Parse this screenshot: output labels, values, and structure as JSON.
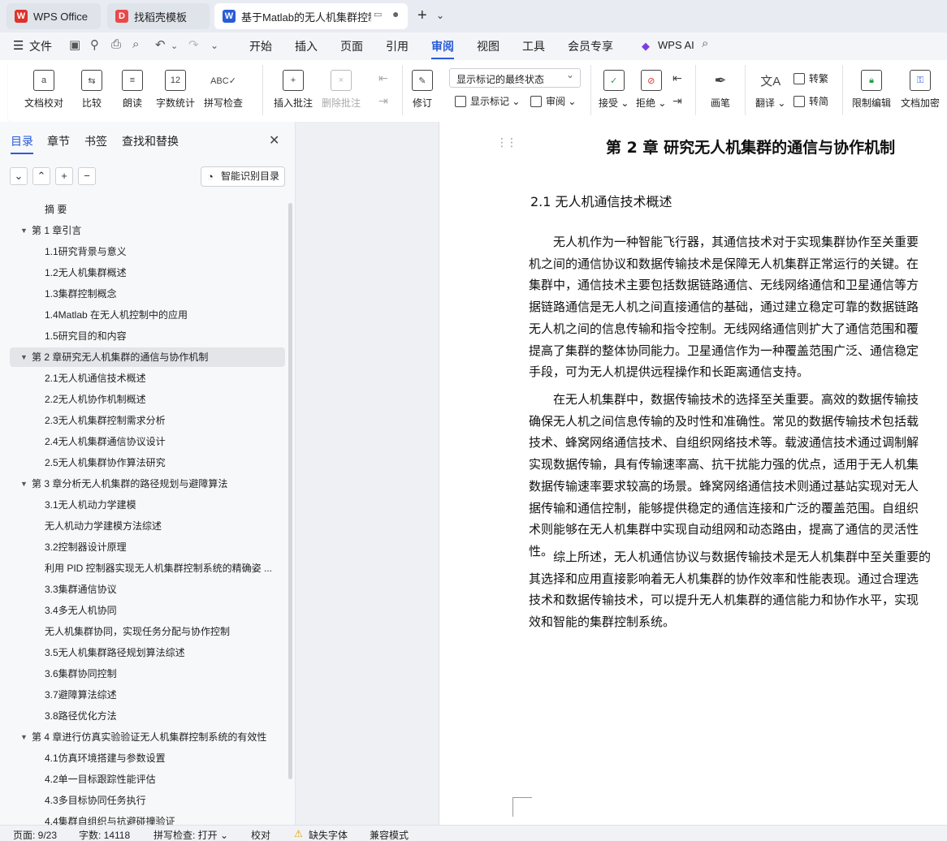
{
  "tabs": [
    {
      "label": "WPS Office",
      "icon": "wps-logo-icon",
      "color": "#e0312b"
    },
    {
      "label": "找稻壳模板",
      "icon": "docer-logo-icon",
      "color": "#e84949"
    },
    {
      "label": "基于Matlab的无人机集群控制",
      "icon": "word-doc-icon",
      "color": "#2a5cd8"
    }
  ],
  "menu": {
    "file": "文件",
    "items": [
      "开始",
      "插入",
      "页面",
      "引用",
      "审阅",
      "视图",
      "工具",
      "会员专享"
    ],
    "active": "审阅",
    "wps_ai": "WPS AI"
  },
  "ribbon": {
    "doc_check": "文档校对",
    "compare": "比较",
    "read_aloud": "朗读",
    "word_count": "字数统计",
    "spell_check": "拼写检查",
    "insert_comment": "插入批注",
    "delete_comment": "删除批注",
    "revise": "修订",
    "markup_state": "显示标记的最终状态",
    "show_markup": "显示标记",
    "review": "审阅",
    "accept": "接受",
    "reject": "拒绝",
    "pen": "画笔",
    "translate": "翻译",
    "to_traditional": "转繁",
    "to_simplified": "转简",
    "restrict_edit": "限制编辑",
    "doc_encrypt": "文档加密"
  },
  "sidebar": {
    "tabs": [
      "目录",
      "章节",
      "书签",
      "查找和替换"
    ],
    "smart_toc": "智能识别目录",
    "toc": [
      {
        "label": "摘 要",
        "level": 2
      },
      {
        "label": "第 1 章引言",
        "level": 1
      },
      {
        "label": "1.1研究背景与意义",
        "level": 2
      },
      {
        "label": "1.2无人机集群概述",
        "level": 2
      },
      {
        "label": "1.3集群控制概念",
        "level": 2
      },
      {
        "label": "1.4Matlab 在无人机控制中的应用",
        "level": 2
      },
      {
        "label": "1.5研究目的和内容",
        "level": 2
      },
      {
        "label": "第 2 章研究无人机集群的通信与协作机制",
        "level": 1,
        "selected": true
      },
      {
        "label": "2.1无人机通信技术概述",
        "level": 2
      },
      {
        "label": "2.2无人机协作机制概述",
        "level": 2
      },
      {
        "label": "2.3无人机集群控制需求分析",
        "level": 2
      },
      {
        "label": "2.4无人机集群通信协议设计",
        "level": 2
      },
      {
        "label": "2.5无人机集群协作算法研究",
        "level": 2
      },
      {
        "label": "第 3 章分析无人机集群的路径规划与避障算法",
        "level": 1
      },
      {
        "label": "3.1无人机动力学建模",
        "level": 2
      },
      {
        "label": "无人机动力学建模方法综述",
        "level": 2
      },
      {
        "label": "3.2控制器设计原理",
        "level": 2
      },
      {
        "label": "利用 PID 控制器实现无人机集群控制系统的精确姿 ...",
        "level": 2
      },
      {
        "label": "3.3集群通信协议",
        "level": 2
      },
      {
        "label": "3.4多无人机协同",
        "level": 2
      },
      {
        "label": "无人机集群协同，实现任务分配与协作控制",
        "level": 2
      },
      {
        "label": "3.5无人机集群路径规划算法综述",
        "level": 2
      },
      {
        "label": "3.6集群协同控制",
        "level": 2
      },
      {
        "label": "3.7避障算法综述",
        "level": 2
      },
      {
        "label": "3.8路径优化方法",
        "level": 2
      },
      {
        "label": "第 4 章进行仿真实验验证无人机集群控制系统的有效性",
        "level": 1
      },
      {
        "label": "4.1仿真环境搭建与参数设置",
        "level": 2
      },
      {
        "label": "4.2单一目标跟踪性能评估",
        "level": 2
      },
      {
        "label": "4.3多目标协同任务执行",
        "level": 2
      },
      {
        "label": "4.4集群自组织与抗避碰撞验证",
        "level": 2
      }
    ]
  },
  "document": {
    "chapter_title": "第 2 章    研究无人机集群的通信与协作机制",
    "section_title": "2.1  无人机通信技术概述",
    "paragraphs": [
      [
        "　　无人机作为一种智能飞行器，其通信技术对于实现集群协作至关重要",
        "机之间的通信协议和数据传输技术是保障无人机集群正常运行的关键。在",
        "集群中，通信技术主要包括数据链路通信、无线网络通信和卫星通信等方",
        "据链路通信是无人机之间直接通信的基础，通过建立稳定可靠的数据链路",
        "无人机之间的信息传输和指令控制。无线网络通信则扩大了通信范围和覆",
        "提高了集群的整体协同能力。卫星通信作为一种覆盖范围广泛、通信稳定",
        "手段，可为无人机提供远程操作和长距离通信支持。"
      ],
      [
        "　　在无人机集群中，数据传输技术的选择至关重要。高效的数据传输技",
        "确保无人机之间信息传输的及时性和准确性。常见的数据传输技术包括载",
        "技术、蜂窝网络通信技术、自组织网络技术等。载波通信技术通过调制解",
        "实现数据传输，具有传输速率高、抗干扰能力强的优点，适用于无人机集",
        "数据传输速率要求较高的场景。蜂窝网络通信技术则通过基站实现对无人",
        "据传输和通信控制，能够提供稳定的通信连接和广泛的覆盖范围。自组织",
        "术则能够在无人机集群中实现自动组网和动态路由，提高了通信的灵活性",
        "性。"
      ],
      [
        "　　综上所述，无人机通信协议与数据传输技术是无人机集群中至关重要的",
        "其选择和应用直接影响着无人机集群的协作效率和性能表现。通过合理选",
        "技术和数据传输技术，可以提升无人机集群的通信能力和协作水平，实现",
        "效和智能的集群控制系统。"
      ]
    ]
  },
  "status": {
    "page": "页面: 9/23",
    "words": "字数: 14118",
    "spell": "拼写检查: 打开",
    "proof": "校对",
    "missing_font": "缺失字体",
    "compat": "兼容模式"
  }
}
